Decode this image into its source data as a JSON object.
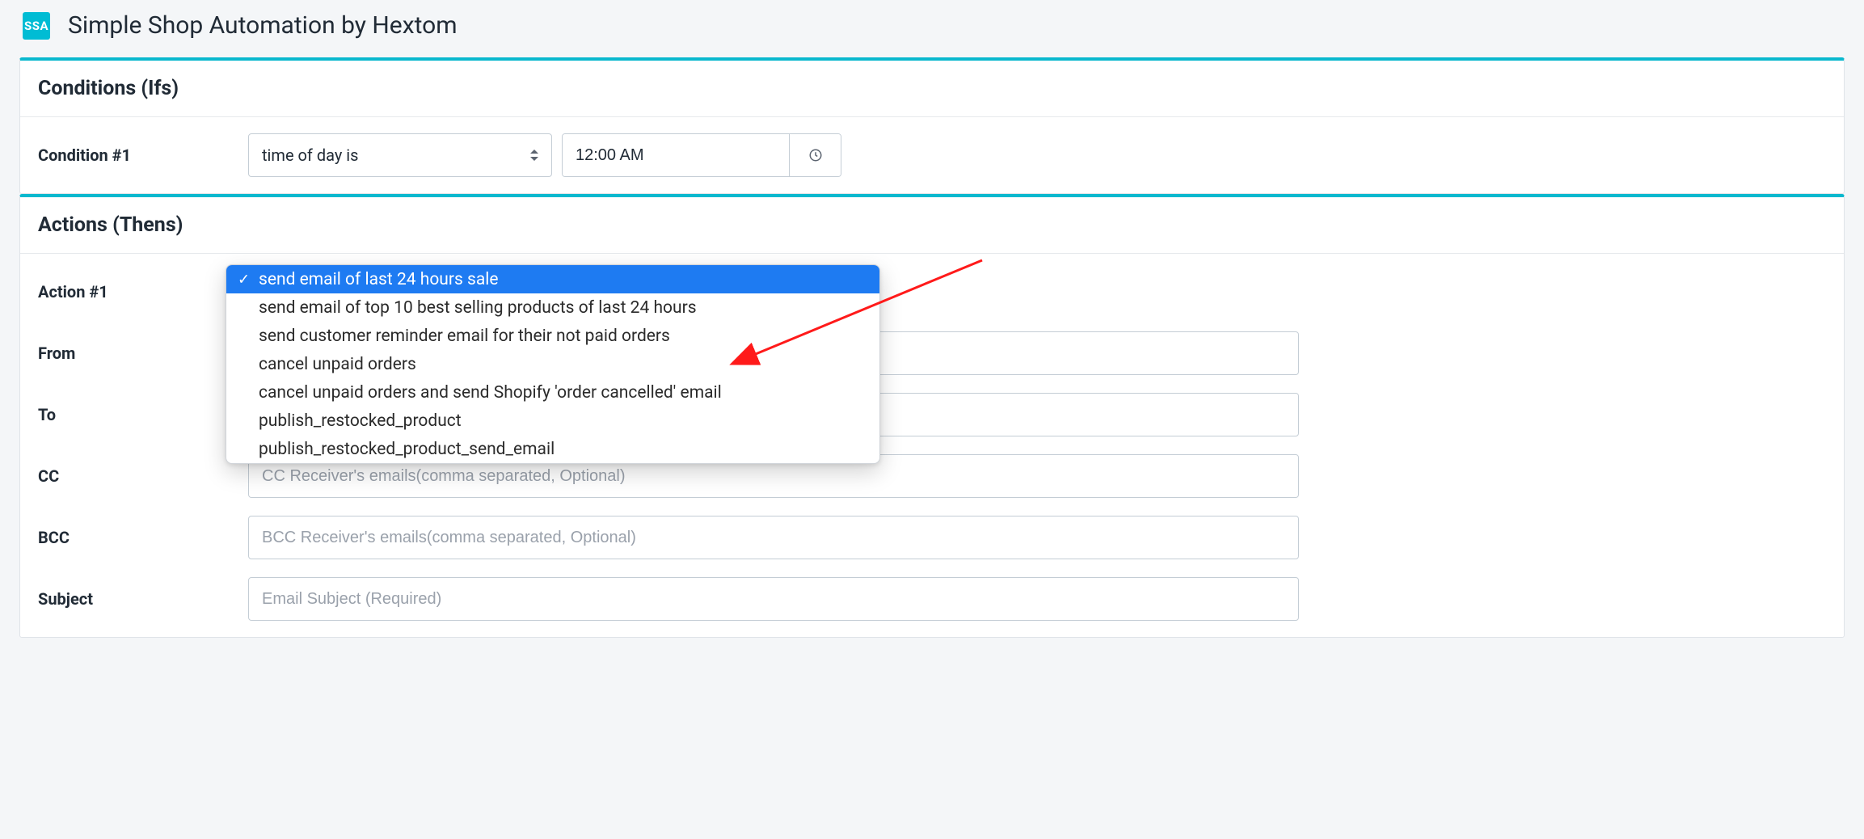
{
  "header": {
    "logo_text": "SSA",
    "title": "Simple Shop Automation by Hextom"
  },
  "conditions": {
    "title": "Conditions (Ifs)",
    "rows": [
      {
        "label": "Condition #1",
        "type_label": "time of day is",
        "time_value": "12:00 AM"
      }
    ]
  },
  "actions": {
    "title": "Actions (Thens)",
    "rows": {
      "action": {
        "label": "Action #1"
      },
      "from": {
        "label": "From"
      },
      "to": {
        "label": "To"
      },
      "cc": {
        "label": "CC",
        "placeholder": "CC Receiver's emails(comma separated, Optional)"
      },
      "bcc": {
        "label": "BCC",
        "placeholder": "BCC Receiver's emails(comma separated, Optional)"
      },
      "subject": {
        "label": "Subject",
        "placeholder": "Email Subject (Required)"
      }
    },
    "dropdown": {
      "selected_index": 0,
      "options": [
        "send email of last 24 hours sale",
        "send email of top 10 best selling products of last 24 hours",
        "send customer reminder email for their not paid orders",
        "cancel unpaid orders",
        "cancel unpaid orders and send Shopify 'order cancelled' email",
        "publish_restocked_product",
        "publish_restocked_product_send_email"
      ]
    }
  }
}
